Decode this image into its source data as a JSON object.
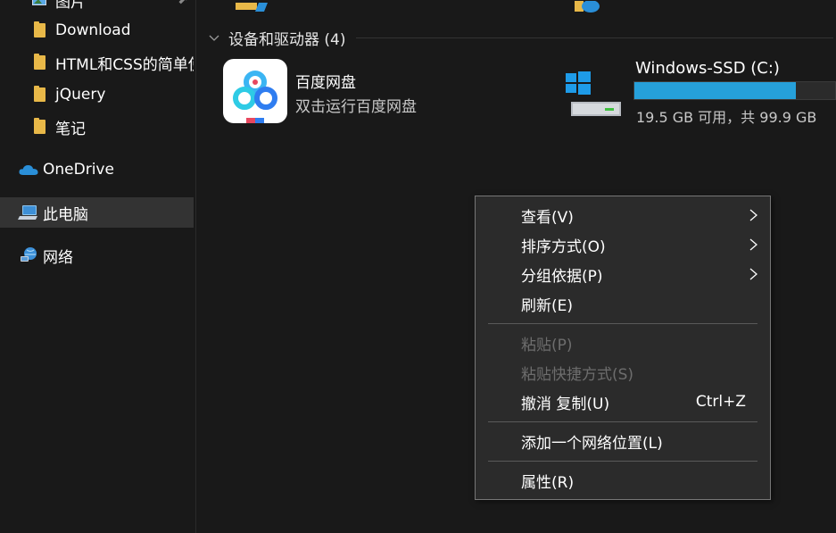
{
  "sidebar": {
    "items": [
      {
        "label": "图片",
        "icon": "pictures-folder-icon"
      },
      {
        "label": "Download",
        "icon": "folder-icon"
      },
      {
        "label": "HTML和CSS的简单使",
        "icon": "folder-icon"
      },
      {
        "label": "jQuery",
        "icon": "folder-icon"
      },
      {
        "label": "笔记",
        "icon": "folder-icon"
      },
      {
        "label": "OneDrive",
        "icon": "onedrive-cloud-icon"
      },
      {
        "label": "此电脑",
        "icon": "this-pc-icon",
        "selected": true
      },
      {
        "label": "网络",
        "icon": "network-icon"
      }
    ]
  },
  "main": {
    "group_title": "设备和驱动器 (4)",
    "baidu": {
      "name": "百度网盘",
      "desc": "双击运行百度网盘"
    },
    "drive": {
      "name": "Windows-SSD (C:)",
      "space": "19.5 GB 可用，共 99.9 GB",
      "used_fraction": 0.805
    }
  },
  "context_menu": {
    "items": [
      {
        "label": "查看(V)",
        "submenu": true
      },
      {
        "label": "排序方式(O)",
        "submenu": true
      },
      {
        "label": "分组依据(P)",
        "submenu": true
      },
      {
        "label": "刷新(E)"
      },
      {
        "label": "粘贴(P)",
        "disabled": true
      },
      {
        "label": "粘贴快捷方式(S)",
        "disabled": true
      },
      {
        "label": "撤消 复制(U)",
        "shortcut": "Ctrl+Z"
      },
      {
        "label": "添加一个网络位置(L)"
      },
      {
        "label": "属性(R)"
      }
    ]
  },
  "colors": {
    "background": "#191919",
    "selected": "#333333",
    "drive_bar": "#26a0da",
    "folder": "#e8b848",
    "menu_bg": "#2b2b2b"
  }
}
